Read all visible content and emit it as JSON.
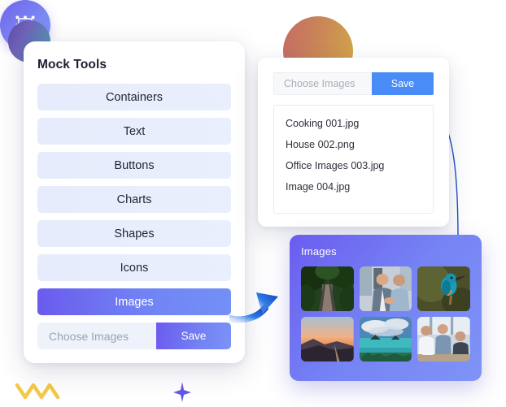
{
  "tools_panel": {
    "title": "Mock Tools",
    "items": [
      {
        "label": "Containers",
        "active": false
      },
      {
        "label": "Text",
        "active": false
      },
      {
        "label": "Buttons",
        "active": false
      },
      {
        "label": "Charts",
        "active": false
      },
      {
        "label": "Shapes",
        "active": false
      },
      {
        "label": "Icons",
        "active": false
      },
      {
        "label": "Images",
        "active": true
      }
    ],
    "upload": {
      "placeholder": "Choose Images",
      "value": "",
      "save_label": "Save"
    }
  },
  "file_panel": {
    "upload": {
      "placeholder": "Choose Images",
      "value": "",
      "save_label": "Save"
    },
    "files": [
      {
        "name": "Cooking 001.jpg"
      },
      {
        "name": "House 002.png"
      },
      {
        "name": "Office Images 003.jpg"
      },
      {
        "name": "Image 004.jpg"
      }
    ]
  },
  "gallery_panel": {
    "title": "Images",
    "thumbnails": [
      {
        "alt": "forest-boardwalk"
      },
      {
        "alt": "two-businessmen-handshake"
      },
      {
        "alt": "kingfisher-bird-on-branch"
      },
      {
        "alt": "sunset-over-mountains"
      },
      {
        "alt": "tropical-ocean-islands"
      },
      {
        "alt": "office-team-meeting"
      }
    ]
  },
  "decorations": {
    "badge_icon": "image-frame-icon",
    "circle_teal": "gradient-circle-purple-teal",
    "circle_sunset": "gradient-circle-red-gold",
    "squiggle": "yellow-zigzag-squiggle",
    "star": "purple-four-point-star-icon",
    "arrow": "blue-curved-arrow-icon",
    "curve": "blue-connector-curve"
  },
  "colors": {
    "accent_purple": "#6b5bef",
    "accent_blue": "#4a8cf7",
    "item_bg": "#e7edfb",
    "text_dark": "#1c2030",
    "muted_text": "#9aa3b4",
    "squiggle_yellow": "#f2c94c"
  }
}
